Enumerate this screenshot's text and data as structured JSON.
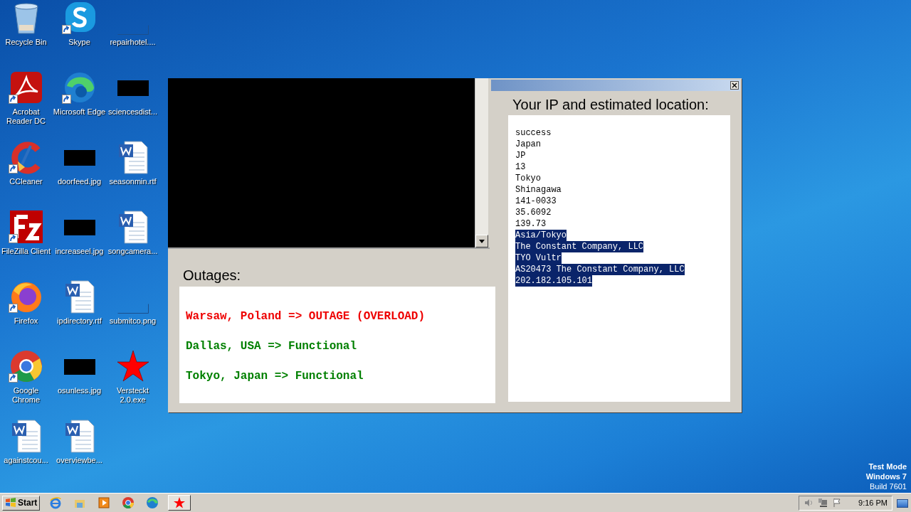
{
  "desktop_icons": [
    {
      "label": "Recycle Bin",
      "kind": "recycle",
      "shortcut": false
    },
    {
      "label": "Acrobat Reader DC",
      "kind": "acrobat",
      "shortcut": true
    },
    {
      "label": "CCleaner",
      "kind": "ccleaner",
      "shortcut": true
    },
    {
      "label": "FileZilla Client",
      "kind": "filezilla",
      "shortcut": true
    },
    {
      "label": "Firefox",
      "kind": "firefox",
      "shortcut": true
    },
    {
      "label": "Google Chrome",
      "kind": "chrome",
      "shortcut": true
    },
    {
      "label": "againstcou...",
      "kind": "word",
      "shortcut": false
    },
    {
      "label": "Skype",
      "kind": "skype",
      "shortcut": true
    },
    {
      "label": "Microsoft Edge",
      "kind": "edge",
      "shortcut": true
    },
    {
      "label": "doorfeed.jpg",
      "kind": "dark-image",
      "shortcut": false
    },
    {
      "label": "increaseel.jpg",
      "kind": "dark-image",
      "shortcut": false
    },
    {
      "label": "ipdirectory.rtf",
      "kind": "word",
      "shortcut": false
    },
    {
      "label": "osunless.jpg",
      "kind": "dark-image",
      "shortcut": false
    },
    {
      "label": "overviewbe...",
      "kind": "word",
      "shortcut": false
    },
    {
      "label": "repairhotel....",
      "kind": "blank-image",
      "shortcut": false
    },
    {
      "label": "sciencesdist...",
      "kind": "dark-image",
      "shortcut": false
    },
    {
      "label": "seasonmin.rtf",
      "kind": "word",
      "shortcut": false
    },
    {
      "label": "songcamera...",
      "kind": "word",
      "shortcut": false
    },
    {
      "label": "submitco.png",
      "kind": "blank-image",
      "shortcut": false
    },
    {
      "label": "Versteckt 2.0.exe",
      "kind": "star",
      "shortcut": false
    }
  ],
  "window": {
    "outages": {
      "title": "Outages:",
      "items": [
        {
          "text": "Warsaw, Poland => OUTAGE (OVERLOAD)",
          "color": "#ee0000"
        },
        {
          "text": "Dallas, USA => Functional",
          "color": "#008000"
        },
        {
          "text": "Tokyo, Japan => Functional",
          "color": "#008000"
        }
      ]
    },
    "location": {
      "title": "Your IP and estimated location:",
      "lines": [
        {
          "text": "success",
          "selected": false
        },
        {
          "text": "Japan",
          "selected": false
        },
        {
          "text": "JP",
          "selected": false
        },
        {
          "text": "13",
          "selected": false
        },
        {
          "text": "Tokyo",
          "selected": false
        },
        {
          "text": "Shinagawa",
          "selected": false
        },
        {
          "text": "141-0033",
          "selected": false
        },
        {
          "text": "35.6092",
          "selected": false
        },
        {
          "text": "139.73",
          "selected": false
        },
        {
          "text": "Asia/Tokyo",
          "selected": true
        },
        {
          "text": "The Constant Company, LLC",
          "selected": true
        },
        {
          "text": "TYO Vultr",
          "selected": true
        },
        {
          "text": "AS20473 The Constant Company, LLC",
          "selected": true
        },
        {
          "text": "202.182.105.101",
          "selected": true
        }
      ]
    }
  },
  "os_watermark": [
    "Test Mode",
    "Windows 7",
    "Build 7601"
  ],
  "taskbar": {
    "start": "Start",
    "pinned": [
      {
        "kind": "ie"
      },
      {
        "kind": "explorer"
      },
      {
        "kind": "media"
      },
      {
        "kind": "chrome"
      },
      {
        "kind": "edge"
      }
    ],
    "running": [
      {
        "kind": "star"
      }
    ],
    "clock": "9:16 PM"
  }
}
